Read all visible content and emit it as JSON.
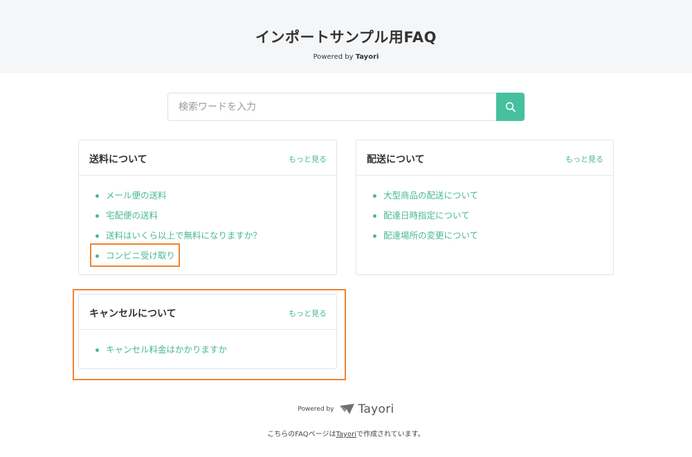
{
  "header": {
    "title": "インポートサンプル用FAQ",
    "powered_prefix": "Powered by ",
    "powered_brand": "Tayori"
  },
  "search": {
    "placeholder": "検索ワードを入力",
    "value": "",
    "button_icon": "search-icon"
  },
  "categories": [
    {
      "title": "送料について",
      "more": "もっと見る",
      "items": [
        "メール便の送料",
        "宅配便の送料",
        "送料はいくら以上で無料になりますか？",
        "コンビニ受け取り"
      ]
    },
    {
      "title": "配送について",
      "more": "もっと見る",
      "items": [
        "大型商品の配送について",
        "配達日時指定について",
        "配達場所の変更について"
      ]
    },
    {
      "title": "キャンセルについて",
      "more": "もっと見る",
      "items": [
        "キャンセル料金はかかりますか"
      ]
    }
  ],
  "footer": {
    "powered": "Powered by",
    "logo_text": "Tayori",
    "note_prefix": "こちらのFAQページは",
    "note_link": "Tayori",
    "note_suffix": "で作成されています。"
  },
  "colors": {
    "accent": "#47c0a0",
    "link": "#47b894",
    "highlight": "#f0822e",
    "header_bg": "#f5f6f8"
  }
}
